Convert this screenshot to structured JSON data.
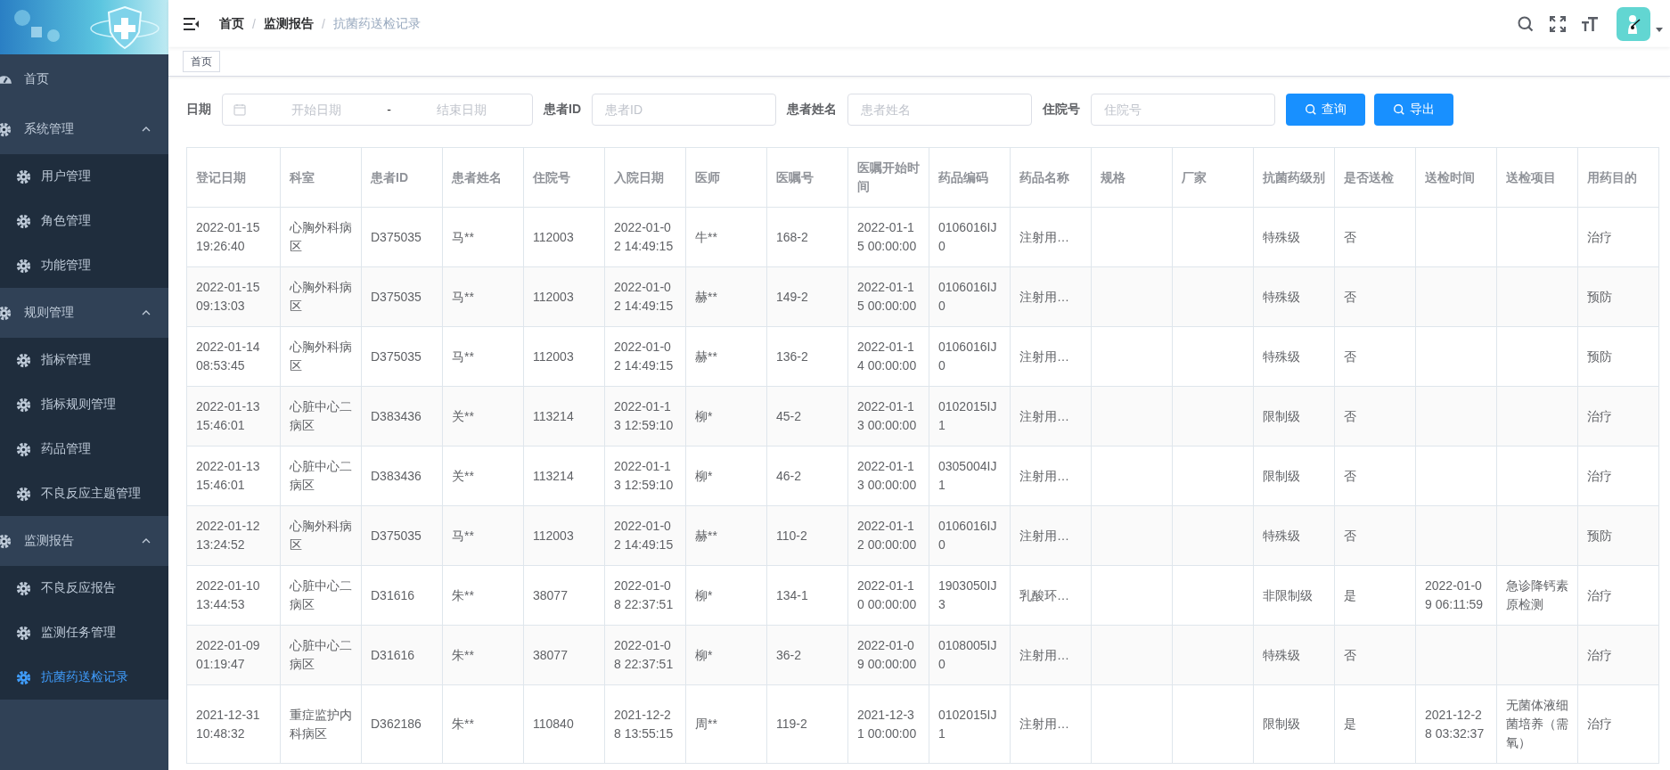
{
  "sidebar": {
    "items": [
      {
        "label": "首页",
        "selected": false
      },
      {
        "label": "系统管理",
        "expanded": true,
        "children": [
          {
            "label": "用户管理",
            "selected": false
          },
          {
            "label": "角色管理",
            "selected": false
          },
          {
            "label": "功能管理",
            "selected": false
          }
        ]
      },
      {
        "label": "规则管理",
        "expanded": true,
        "children": [
          {
            "label": "指标管理",
            "selected": false
          },
          {
            "label": "指标规则管理",
            "selected": false
          },
          {
            "label": "药品管理",
            "selected": false
          },
          {
            "label": "不良反应主题管理",
            "selected": false
          }
        ]
      },
      {
        "label": "监测报告",
        "expanded": true,
        "children": [
          {
            "label": "不良反应报告",
            "selected": false
          },
          {
            "label": "监测任务管理",
            "selected": false
          },
          {
            "label": "抗菌药送检记录",
            "selected": true
          }
        ]
      }
    ]
  },
  "breadcrumb": {
    "items": [
      {
        "label": "首页",
        "current": false
      },
      {
        "label": "监测报告",
        "current": false
      },
      {
        "label": "抗菌药送检记录",
        "current": true
      }
    ],
    "separators": [
      "/",
      "/"
    ]
  },
  "tags": [
    {
      "label": "首页"
    }
  ],
  "filters": {
    "date_label": "日期",
    "start_placeholder": "开始日期",
    "range_separator": "-",
    "end_placeholder": "结束日期",
    "fields": [
      {
        "label": "患者ID",
        "placeholder": "患者ID"
      },
      {
        "label": "患者姓名",
        "placeholder": "患者姓名"
      },
      {
        "label": "住院号",
        "placeholder": "住院号"
      }
    ],
    "buttons": [
      "查询",
      "导出"
    ]
  },
  "table": {
    "columns": [
      "登记日期",
      "科室",
      "患者ID",
      "患者姓名",
      "住院号",
      "入院日期",
      "医师",
      "医嘱号",
      "医嘱开始时间",
      "药品编码",
      "药品名称",
      "规格",
      "厂家",
      "抗菌药级别",
      "是否送检",
      "送检时间",
      "送检项目",
      "用药目的"
    ],
    "rows": [
      [
        "2022-01-15 19:26:40",
        "心胸外科病区",
        "D375035",
        "马**",
        "112003",
        "2022-01-02 14:49:15",
        "牛**",
        "168-2",
        "2022-01-15 00:00:00",
        "0106016IJ0",
        "注射用…",
        null,
        null,
        "特殊级",
        "否",
        null,
        null,
        "治疗"
      ],
      [
        "2022-01-15 09:13:03",
        "心胸外科病区",
        "D375035",
        "马**",
        "112003",
        "2022-01-02 14:49:15",
        "赫**",
        "149-2",
        "2022-01-15 00:00:00",
        "0106016IJ0",
        "注射用…",
        null,
        null,
        "特殊级",
        "否",
        null,
        null,
        "预防"
      ],
      [
        "2022-01-14 08:53:45",
        "心胸外科病区",
        "D375035",
        "马**",
        "112003",
        "2022-01-02 14:49:15",
        "赫**",
        "136-2",
        "2022-01-14 00:00:00",
        "0106016IJ0",
        "注射用…",
        null,
        null,
        "特殊级",
        "否",
        null,
        null,
        "预防"
      ],
      [
        "2022-01-13 15:46:01",
        "心脏中心二病区",
        "D383436",
        "关**",
        "113214",
        "2022-01-13 12:59:10",
        "柳*",
        "45-2",
        "2022-01-13 00:00:00",
        "0102015IJ1",
        "注射用…",
        null,
        null,
        "限制级",
        "否",
        null,
        null,
        "治疗"
      ],
      [
        "2022-01-13 15:46:01",
        "心脏中心二病区",
        "D383436",
        "关**",
        "113214",
        "2022-01-13 12:59:10",
        "柳*",
        "46-2",
        "2022-01-13 00:00:00",
        "0305004IJ1",
        "注射用…",
        null,
        null,
        "限制级",
        "否",
        null,
        null,
        "治疗"
      ],
      [
        "2022-01-12 13:24:52",
        "心胸外科病区",
        "D375035",
        "马**",
        "112003",
        "2022-01-02 14:49:15",
        "赫**",
        "110-2",
        "2022-01-12 00:00:00",
        "0106016IJ0",
        "注射用…",
        null,
        null,
        "特殊级",
        "否",
        null,
        null,
        "预防"
      ],
      [
        "2022-01-10 13:44:53",
        "心脏中心二病区",
        "D31616",
        "朱**",
        "38077",
        "2022-01-08 22:37:51",
        "柳*",
        "134-1",
        "2022-01-10 00:00:00",
        "1903050IJ3",
        "乳酸环…",
        null,
        null,
        "非限制级",
        "是",
        "2022-01-09 06:11:59",
        "急诊降钙素原检测",
        "治疗"
      ],
      [
        "2022-01-09 01:19:47",
        "心脏中心二病区",
        "D31616",
        "朱**",
        "38077",
        "2022-01-08 22:37:51",
        "柳*",
        "36-2",
        "2022-01-09 00:00:00",
        "0108005IJ0",
        "注射用…",
        null,
        null,
        "特殊级",
        "否",
        null,
        null,
        "治疗"
      ],
      [
        "2021-12-31 10:48:32",
        "重症监护内科病区",
        "D362186",
        "朱**",
        "110840",
        "2021-12-28 13:55:15",
        "周**",
        "119-2",
        "2021-12-31 00:00:00",
        "0102015IJ1",
        "注射用…",
        null,
        null,
        "限制级",
        "是",
        "2021-12-28 03:32:37",
        "无菌体液细菌培养（需氧）",
        "治疗"
      ]
    ]
  }
}
